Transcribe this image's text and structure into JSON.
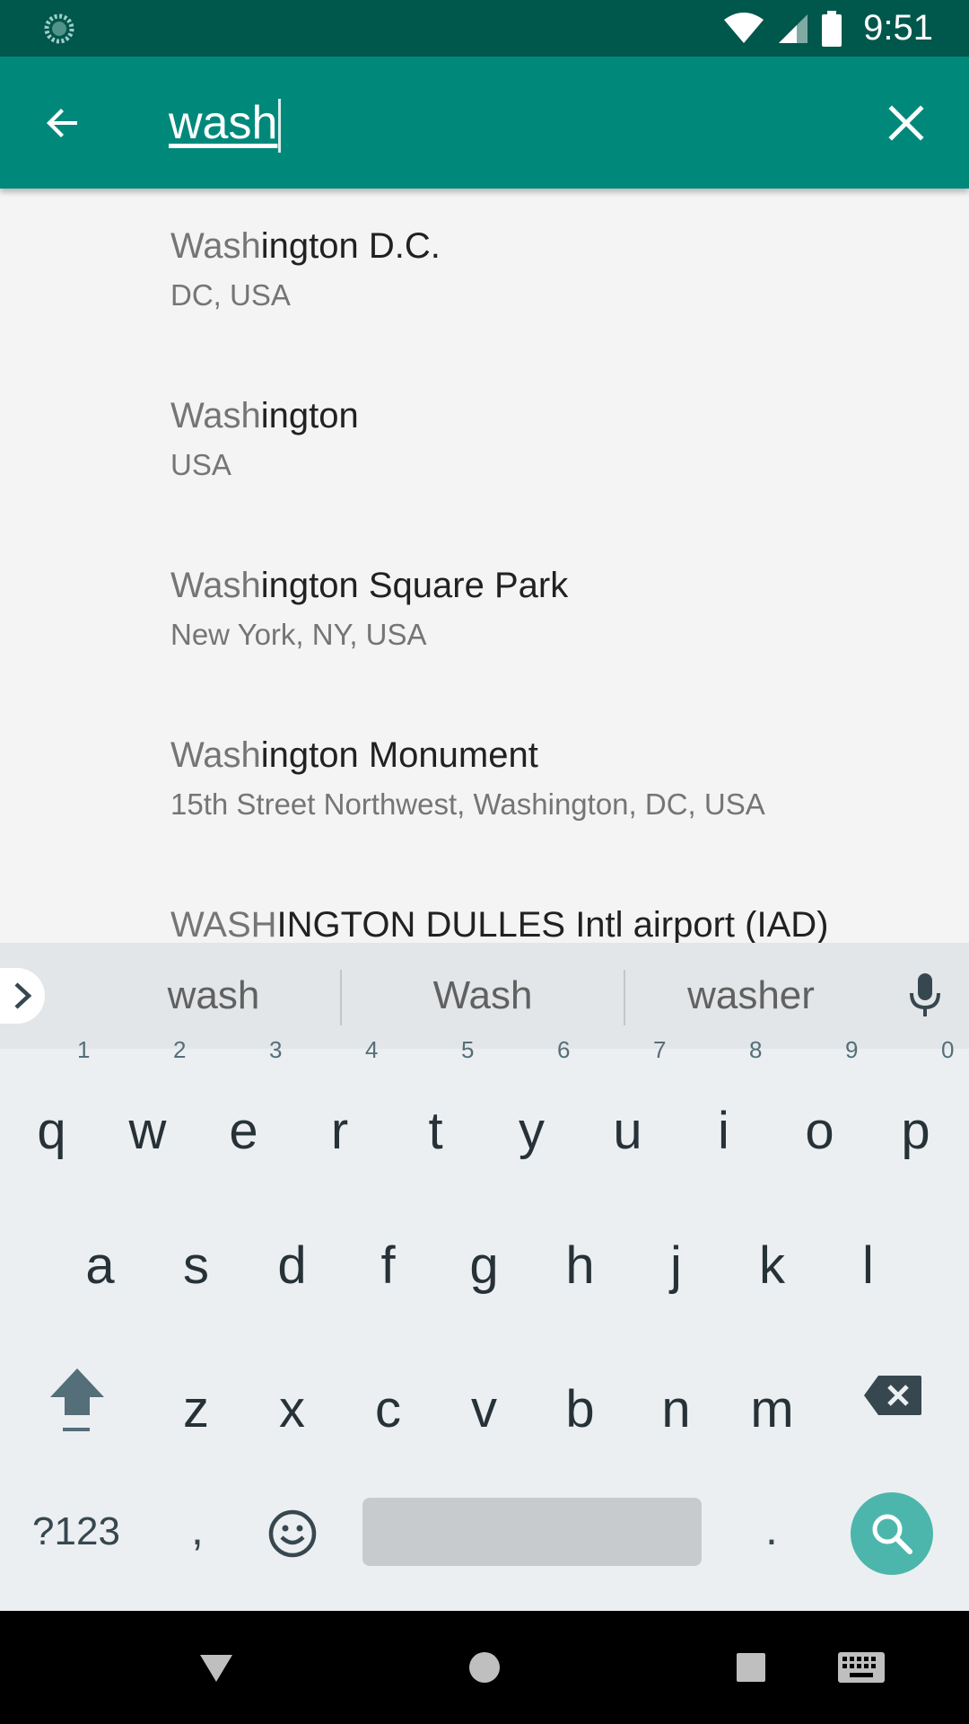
{
  "status_bar": {
    "time": "9:51"
  },
  "search": {
    "query": "wash"
  },
  "results": [
    {
      "match": "Wash",
      "rest": "ington D.C.",
      "subtitle": "DC, USA"
    },
    {
      "match": "Wash",
      "rest": "ington",
      "subtitle": "USA"
    },
    {
      "match": "Wash",
      "rest": "ington Square Park",
      "subtitle": "New York, NY, USA"
    },
    {
      "match": "Wash",
      "rest": "ington Monument",
      "subtitle": "15th Street Northwest, Washington, DC, USA"
    },
    {
      "match": "WASH",
      "rest": "INGTON DULLES Intl airport (IAD)",
      "subtitle": ""
    }
  ],
  "keyboard": {
    "suggestions": [
      "wash",
      "Wash",
      "washer"
    ],
    "row1": [
      "q",
      "w",
      "e",
      "r",
      "t",
      "y",
      "u",
      "i",
      "o",
      "p"
    ],
    "row1_hints": [
      "1",
      "2",
      "3",
      "4",
      "5",
      "6",
      "7",
      "8",
      "9",
      "0"
    ],
    "row2": [
      "a",
      "s",
      "d",
      "f",
      "g",
      "h",
      "j",
      "k",
      "l"
    ],
    "row3": [
      "z",
      "x",
      "c",
      "v",
      "b",
      "n",
      "m"
    ],
    "symbols_label": "?123",
    "comma": ",",
    "period": "."
  },
  "colors": {
    "status_bar": "#00574b",
    "toolbar": "#00897b",
    "action_key": "#4db6ac"
  },
  "icons": {
    "status_left": "sync-icon",
    "status_right": [
      "wifi-icon",
      "cell-signal-icon",
      "battery-icon"
    ],
    "toolbar": [
      "back-arrow-icon",
      "close-icon"
    ],
    "keyboard": [
      "chevron-right-icon",
      "mic-icon",
      "shift-icon",
      "backspace-icon",
      "emoji-icon",
      "search-icon"
    ],
    "nav": [
      "nav-back-icon",
      "nav-home-icon",
      "nav-recents-icon",
      "keyboard-switch-icon"
    ]
  }
}
